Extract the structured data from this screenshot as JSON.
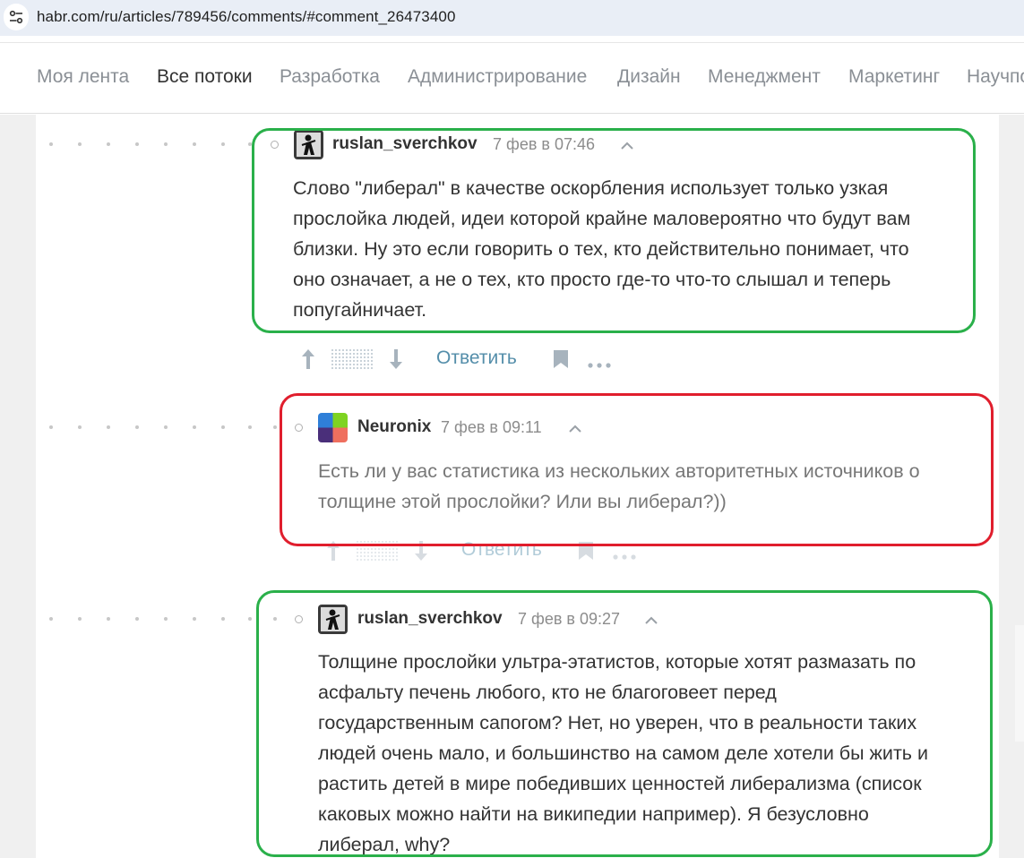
{
  "browser": {
    "url": "habr.com/ru/articles/789456/comments/#comment_26473400",
    "site_icon": "tune-icon"
  },
  "nav": {
    "items": [
      "Моя лента",
      "Все потоки",
      "Разработка",
      "Администрирование",
      "Дизайн",
      "Менеджмент",
      "Маркетинг",
      "Научпо"
    ],
    "active_index": 1
  },
  "comments": [
    {
      "author": "ruslan_sverchkov",
      "time": "7 фев в 07:46",
      "lines": [
        "Слово \"либерал\" в качестве оскорбления использует только узкая",
        "прослойка людей, идеи которой крайне маловероятно что будут вам",
        "близки. Ну это если говорить о тех, кто действительно понимает, что",
        "оно означает, а не о тех, кто просто где-то что-то слышал и теперь",
        "попугайничает."
      ],
      "highlight": "green",
      "avatar": "bw-figure-avatar"
    },
    {
      "author": "Neuronix",
      "time": "7 фев в 09:11",
      "lines": [
        "Есть ли у вас статистика из нескольких авторитетных источников о",
        "толщине этой прослойки? Или вы либерал?))"
      ],
      "highlight": "red",
      "avatar": "color-tiles-avatar"
    },
    {
      "author": "ruslan_sverchkov",
      "time": "7 фев в 09:27",
      "lines": [
        "Толщине прослойки ультра-этатистов, которые хотят размазать по",
        "асфальту печень любого, кто не благоговеет перед",
        "государственным сапогом? Нет, но уверен, что в реальности таких",
        "людей очень мало, и большинство на самом деле хотели бы жить и",
        "растить детей в мире победивших ценностей либерализма (список",
        "каковых можно найти на википедии например). Я безусловно",
        "либерал, why?"
      ],
      "highlight": "green",
      "avatar": "bw-figure-avatar"
    }
  ],
  "actions": {
    "reply_label": "Ответить",
    "icons": [
      "upvote-arrow-icon",
      "score-hidden-icon",
      "downvote-arrow-icon",
      "bookmark-icon",
      "more-icon"
    ]
  },
  "colors": {
    "highlight_green": "#2ab04a",
    "highlight_red": "#e01e2d",
    "reply_link": "#548eaa",
    "muted_text": "#8c8c8c"
  }
}
